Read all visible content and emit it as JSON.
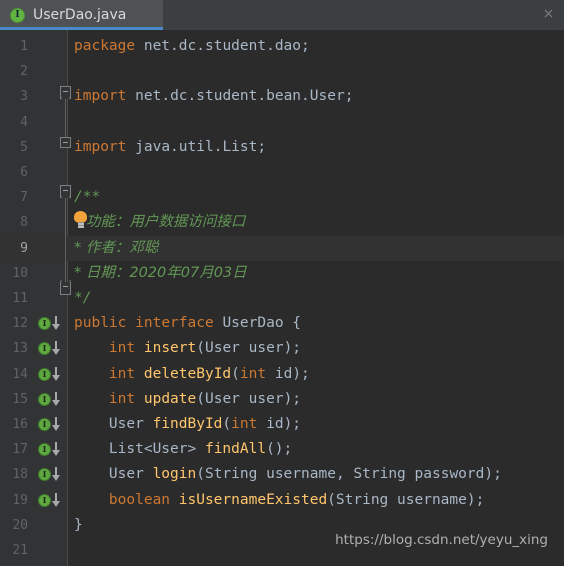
{
  "tab": {
    "icon": "interface-icon",
    "icon_letter": "I",
    "title": "UserDao.java",
    "close": "×"
  },
  "editor": {
    "language": "java",
    "current_line": 9,
    "total_lines": 21,
    "colors": {
      "background": "#2B2B2B",
      "gutter": "#313335",
      "tab_active": "#4E5254",
      "tab_underline": "#4A88C7",
      "keyword": "#CC7832",
      "identifier": "#A9B7C6",
      "method": "#FFC66D",
      "comment": "#629755",
      "line_number": "#606366",
      "current_line_highlight": "#323232",
      "marker_green": "#5EA741",
      "bulb_amber": "#F2A33C"
    },
    "lines": [
      {
        "n": "1",
        "text": "package net.dc.student.dao;"
      },
      {
        "n": "2",
        "text": ""
      },
      {
        "n": "3",
        "text": "import net.dc.student.bean.User;"
      },
      {
        "n": "4",
        "text": ""
      },
      {
        "n": "5",
        "text": "import java.util.List;"
      },
      {
        "n": "6",
        "text": ""
      },
      {
        "n": "7",
        "text": "/**"
      },
      {
        "n": "8",
        "text": "* 功能：用户数据访问接口"
      },
      {
        "n": "9",
        "text": "* 作者：邓聪"
      },
      {
        "n": "10",
        "text": "* 日期：2020年07月03日"
      },
      {
        "n": "11",
        "text": "*/"
      },
      {
        "n": "12",
        "text": "public interface UserDao {"
      },
      {
        "n": "13",
        "text": "    int insert(User user);"
      },
      {
        "n": "14",
        "text": "    int deleteById(int id);"
      },
      {
        "n": "15",
        "text": "    int update(User user);"
      },
      {
        "n": "16",
        "text": "    User findById(int id);"
      },
      {
        "n": "17",
        "text": "    List<User> findAll();"
      },
      {
        "n": "18",
        "text": "    User login(String username, String password);"
      },
      {
        "n": "19",
        "text": "    boolean isUsernameExisted(String username);"
      },
      {
        "n": "20",
        "text": "}"
      },
      {
        "n": "21",
        "text": ""
      }
    ],
    "gutter_markers": {
      "fold_start_line": "3",
      "fold_lines": [
        "5",
        "7",
        "11"
      ],
      "implemented_lines": [
        "12",
        "13",
        "14",
        "15",
        "16",
        "17",
        "18",
        "19"
      ],
      "implemented_letter": "I",
      "bulb_line": "8"
    }
  },
  "watermark": "https://blog.csdn.net/yeyu_xing"
}
